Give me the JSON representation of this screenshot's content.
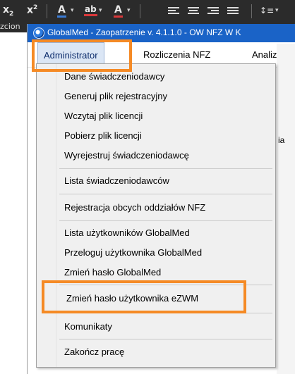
{
  "toolbar": {
    "subscript": "x",
    "subscript_mark": "2",
    "superscript": "x",
    "superscript_mark": "2",
    "font_color_letter": "A",
    "highlight_label": "ab",
    "text_color_letter": "A",
    "bottom_fragment": "zcion"
  },
  "window": {
    "title": "GlobalMed - Zaopatrzenie v. 4.1.1.0 - OW NFZ W K"
  },
  "menu": {
    "items": [
      "Administrator",
      "Rozliczenia NFZ",
      "Analizy/Z"
    ]
  },
  "background": {
    "fragment_1": "ia"
  },
  "dropdown": {
    "items": [
      "Dane świadczeniodawcy",
      "Generuj plik rejestracyjny",
      "Wczytaj plik licencji",
      "Pobierz plik licencji",
      "Wyrejestruj świadczeniodawcę",
      "Lista świadczeniodawców",
      "Rejestracja obcych oddziałów NFZ",
      "Lista użytkowników GlobalMed",
      "Przeloguj użytkownika GlobalMed",
      "Zmień hasło GlobalMed",
      "Zmień hasło użytkownika eZWM",
      "Komunikaty",
      "Zakończ pracę"
    ]
  },
  "colors": {
    "title_bar": "#1a63c7",
    "highlight": "#f58a25",
    "toolbar_bg": "#2b2b2b"
  }
}
